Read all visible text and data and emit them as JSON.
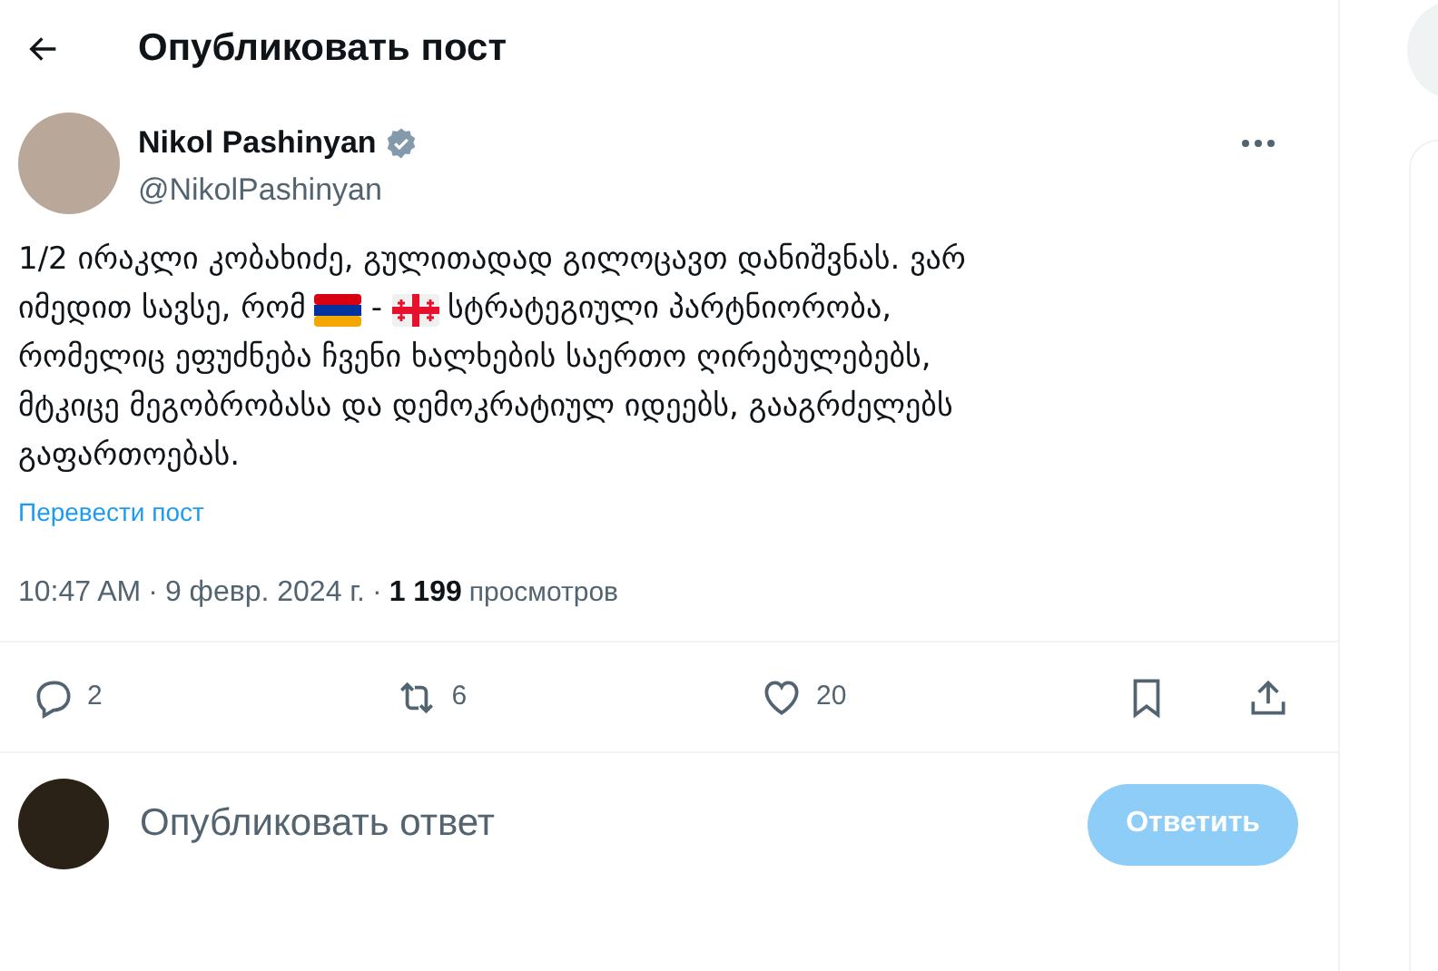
{
  "header": {
    "title": "Опубликовать пост"
  },
  "author": {
    "name": "Nikol Pashinyan",
    "verified": true,
    "handle": "@NikolPashinyan"
  },
  "post": {
    "lines": [
      [
        {
          "kind": "text",
          "text": "1/2 ირაკლი კობახიძე, გულითადად გილოცავთ დანიშვნას. ვარ"
        }
      ],
      [
        {
          "kind": "text",
          "text": "იმედით სავსე, რომ"
        },
        {
          "kind": "flag"
        },
        {
          "kind": "text",
          "text": "-"
        },
        {
          "kind": "flag"
        },
        {
          "kind": "text",
          "text": "სტრატეგიული პარტნიორობა,"
        }
      ],
      [
        {
          "kind": "text",
          "text": "რომელიც ეფუძნება ჩვენი ხალხების საერთო ღირებულებებს,"
        }
      ],
      [
        {
          "kind": "text",
          "text": "მტკიცე მეგობრობასა და დემოკრატიულ იდეებს, გააგრძელებს"
        }
      ],
      [
        {
          "kind": "text",
          "text": "გაფართოებას."
        }
      ]
    ],
    "separators": [
      "·",
      "·"
    ],
    "translate_link": "Перевести пост",
    "time": "10:47 AM",
    "date": "9 февр. 2024 г.",
    "views_count": "1 199",
    "views_label": "просмотров"
  },
  "actions": [
    {
      "kind": "reply",
      "count": "2"
    },
    {
      "kind": "repost",
      "count": "6"
    },
    {
      "kind": "like",
      "count": "20"
    },
    {
      "kind": "bookmark"
    },
    {
      "kind": "share"
    }
  ],
  "reply_box": {
    "placeholder": "Опубликовать ответ",
    "button": "Ответить",
    "disabled": true
  }
}
